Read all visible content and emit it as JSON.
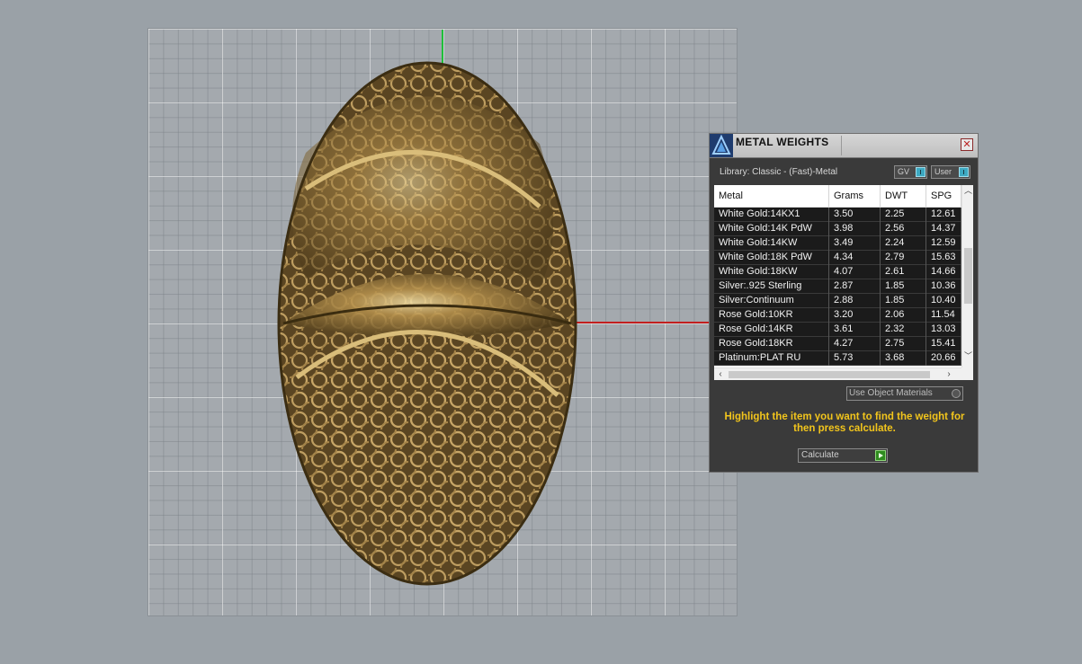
{
  "viewport": {
    "colors": {
      "y_axis": "#1fbf3a",
      "x_axis": "#c21f1f",
      "model": "#8a6f3c"
    }
  },
  "panel": {
    "title": "METAL WEIGHTS",
    "close_icon": "close-icon",
    "library_label": "Library: Classic - (Fast)-Metal",
    "gv_toggle": "GV",
    "user_toggle": "User",
    "table": {
      "headers": [
        "Metal",
        "Grams",
        "DWT",
        "SPG"
      ],
      "rows": [
        [
          "White Gold:14KX1",
          "3.50",
          "2.25",
          "12.61"
        ],
        [
          "White Gold:14K PdW",
          "3.98",
          "2.56",
          "14.37"
        ],
        [
          "White Gold:14KW",
          "3.49",
          "2.24",
          "12.59"
        ],
        [
          "White Gold:18K PdW",
          "4.34",
          "2.79",
          "15.63"
        ],
        [
          "White Gold:18KW",
          "4.07",
          "2.61",
          "14.66"
        ],
        [
          "Silver:.925 Sterling",
          "2.87",
          "1.85",
          "10.36"
        ],
        [
          "Silver:Continuum",
          "2.88",
          "1.85",
          "10.40"
        ],
        [
          "Rose Gold:10KR",
          "3.20",
          "2.06",
          "11.54"
        ],
        [
          "Rose Gold:14KR",
          "3.61",
          "2.32",
          "13.03"
        ],
        [
          "Rose Gold:18KR",
          "4.27",
          "2.75",
          "15.41"
        ],
        [
          "Platinum:PLAT RU",
          "5.73",
          "3.68",
          "20.66"
        ]
      ]
    },
    "use_object_materials": "Use Object Materials",
    "hint": "Highlight the item you want to find the weight for then press calculate.",
    "calculate_label": "Calculate",
    "colors": {
      "hint": "#f2c51c",
      "toggle": "#3da9c2",
      "calculate": "#2f8c1f"
    }
  }
}
